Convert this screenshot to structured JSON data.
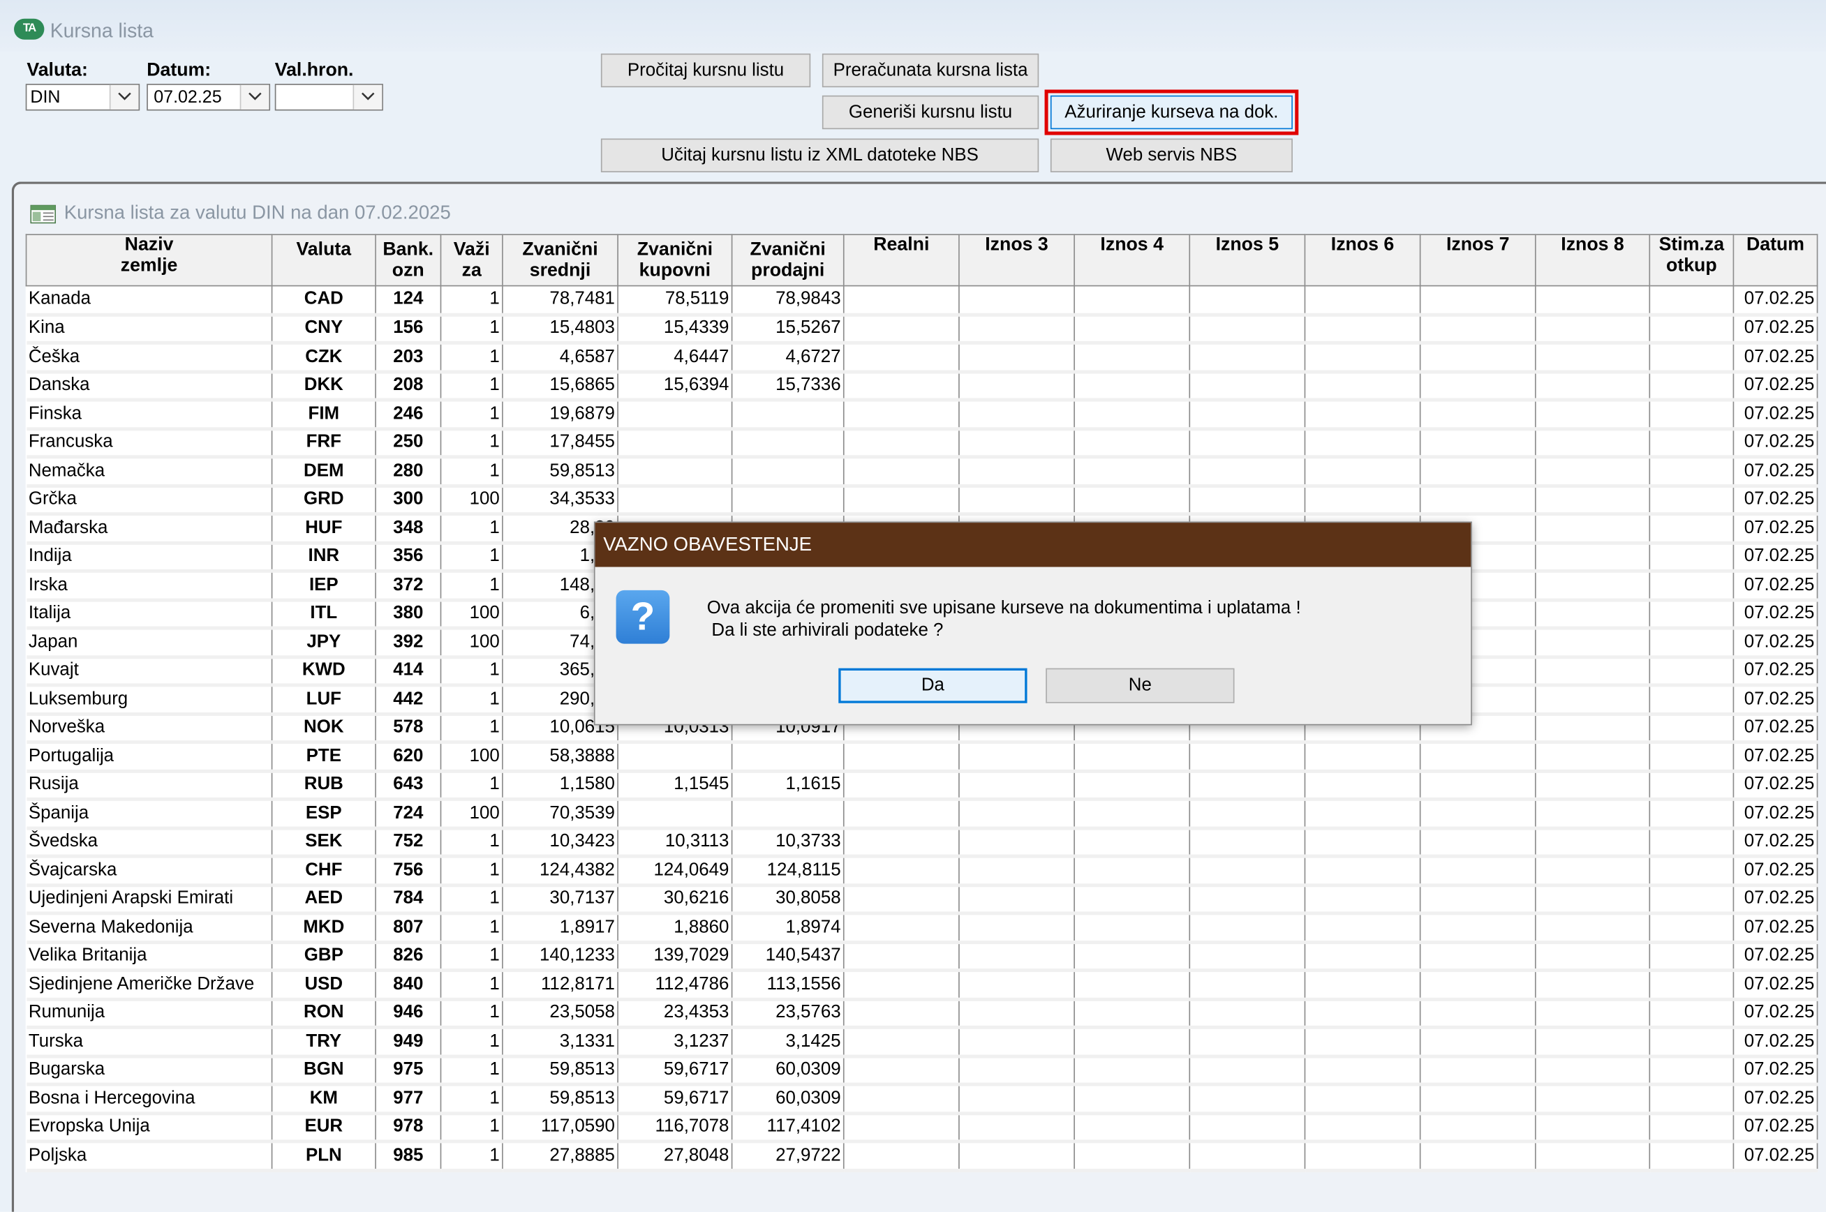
{
  "window": {
    "title": "Kursna lista",
    "icon": "app-logo-icon"
  },
  "filters": {
    "currency_label": "Valuta:",
    "currency_value": "DIN",
    "date_label": "Datum:",
    "date_value": "07.02.25",
    "chron_label": "Val.hron.",
    "chron_value": ""
  },
  "buttons": {
    "read": "Pročitaj kursnu listu",
    "recalculated": "Preračunata kursna lista",
    "generate": "Generiši kursnu listu",
    "update_docs": "Ažuriranje kurseva na dok.",
    "load_xml": "Učitaj kursnu listu iz XML datoteke NBS",
    "web_service": "Web servis NBS"
  },
  "panel": {
    "title": "Kursna lista za valutu DIN na dan 07.02.2025"
  },
  "table": {
    "headers": [
      [
        "Naziv",
        "zemlje"
      ],
      [
        "Valuta",
        ""
      ],
      [
        "Bank.",
        "ozn"
      ],
      [
        "Važi",
        "za"
      ],
      [
        "Zvanični",
        "srednji"
      ],
      [
        "Zvanični",
        "kupovni"
      ],
      [
        "Zvanični",
        "prodajni"
      ],
      [
        "Realni",
        ""
      ],
      [
        "Iznos 3",
        ""
      ],
      [
        "Iznos 4",
        ""
      ],
      [
        "Iznos 5",
        ""
      ],
      [
        "Iznos 6",
        ""
      ],
      [
        "Iznos 7",
        ""
      ],
      [
        "Iznos 8",
        ""
      ],
      [
        "Stim.za",
        "otkup"
      ],
      [
        "Datum",
        ""
      ]
    ],
    "rows": [
      [
        "Kanada",
        "CAD",
        "124",
        "1",
        "78,7481",
        "78,5119",
        "78,9843",
        "07.02.25"
      ],
      [
        "Kina",
        "CNY",
        "156",
        "1",
        "15,4803",
        "15,4339",
        "15,5267",
        "07.02.25"
      ],
      [
        "Češka",
        "CZK",
        "203",
        "1",
        "4,6587",
        "4,6447",
        "4,6727",
        "07.02.25"
      ],
      [
        "Danska",
        "DKK",
        "208",
        "1",
        "15,6865",
        "15,6394",
        "15,7336",
        "07.02.25"
      ],
      [
        "Finska",
        "FIM",
        "246",
        "1",
        "19,6879",
        "",
        "",
        "07.02.25"
      ],
      [
        "Francuska",
        "FRF",
        "250",
        "1",
        "17,8455",
        "",
        "",
        "07.02.25"
      ],
      [
        "Nemačka",
        "DEM",
        "280",
        "1",
        "59,8513",
        "",
        "",
        "07.02.25"
      ],
      [
        "Grčka",
        "GRD",
        "300",
        "100",
        "34,3533",
        "",
        "",
        "07.02.25"
      ],
      [
        "Mađarska",
        "HUF",
        "348",
        "1",
        "28,89",
        "",
        "",
        "07.02.25"
      ],
      [
        "Indija",
        "INR",
        "356",
        "1",
        "1,28",
        "",
        "",
        "07.02.25"
      ],
      [
        "Irska",
        "IEP",
        "372",
        "1",
        "148,63",
        "",
        "",
        "07.02.25"
      ],
      [
        "Italija",
        "ITL",
        "380",
        "100",
        "6,04",
        "",
        "",
        "07.02.25"
      ],
      [
        "Japan",
        "JPY",
        "392",
        "100",
        "74,41",
        "",
        "",
        "07.02.25"
      ],
      [
        "Kuvajt",
        "KWD",
        "414",
        "1",
        "365,35",
        "",
        "",
        "07.02.25"
      ],
      [
        "Luksemburg",
        "LUF",
        "442",
        "1",
        "290,18",
        "",
        "",
        "07.02.25"
      ],
      [
        "Norveška",
        "NOK",
        "578",
        "1",
        "10,0615",
        "10,0313",
        "10,0917",
        "07.02.25"
      ],
      [
        "Portugalija",
        "PTE",
        "620",
        "100",
        "58,3888",
        "",
        "",
        "07.02.25"
      ],
      [
        "Rusija",
        "RUB",
        "643",
        "1",
        "1,1580",
        "1,1545",
        "1,1615",
        "07.02.25"
      ],
      [
        "Španija",
        "ESP",
        "724",
        "100",
        "70,3539",
        "",
        "",
        "07.02.25"
      ],
      [
        "Švedska",
        "SEK",
        "752",
        "1",
        "10,3423",
        "10,3113",
        "10,3733",
        "07.02.25"
      ],
      [
        "Švajcarska",
        "CHF",
        "756",
        "1",
        "124,4382",
        "124,0649",
        "124,8115",
        "07.02.25"
      ],
      [
        "Ujedinjeni Arapski Emirati",
        "AED",
        "784",
        "1",
        "30,7137",
        "30,6216",
        "30,8058",
        "07.02.25"
      ],
      [
        "Severna Makedonija",
        "MKD",
        "807",
        "1",
        "1,8917",
        "1,8860",
        "1,8974",
        "07.02.25"
      ],
      [
        "Velika Britanija",
        "GBP",
        "826",
        "1",
        "140,1233",
        "139,7029",
        "140,5437",
        "07.02.25"
      ],
      [
        "Sjedinjene Američke Države",
        "USD",
        "840",
        "1",
        "112,8171",
        "112,4786",
        "113,1556",
        "07.02.25"
      ],
      [
        "Rumunija",
        "RON",
        "946",
        "1",
        "23,5058",
        "23,4353",
        "23,5763",
        "07.02.25"
      ],
      [
        "Turska",
        "TRY",
        "949",
        "1",
        "3,1331",
        "3,1237",
        "3,1425",
        "07.02.25"
      ],
      [
        "Bugarska",
        "BGN",
        "975",
        "1",
        "59,8513",
        "59,6717",
        "60,0309",
        "07.02.25"
      ],
      [
        "Bosna i Hercegovina",
        "KM",
        "977",
        "1",
        "59,8513",
        "59,6717",
        "60,0309",
        "07.02.25"
      ],
      [
        "Evropska Unija",
        "EUR",
        "978",
        "1",
        "117,0590",
        "116,7078",
        "117,4102",
        "07.02.25"
      ],
      [
        "Poljska",
        "PLN",
        "985",
        "1",
        "27,8885",
        "27,8048",
        "27,9722",
        "07.02.25"
      ]
    ]
  },
  "dialog": {
    "title": "VAZNO OBAVESTENJE",
    "icon": "question-icon",
    "line1": "Ova akcija će promeniti sve upisane kurseve na dokumentima i uplatama !",
    "line2": "Da li ste arhivirali podateke ?",
    "yes": "Da",
    "no": "Ne"
  },
  "colors": {
    "dialog_header": "#5c3216",
    "highlight": "#e00000",
    "background": "#eaf1f8"
  }
}
